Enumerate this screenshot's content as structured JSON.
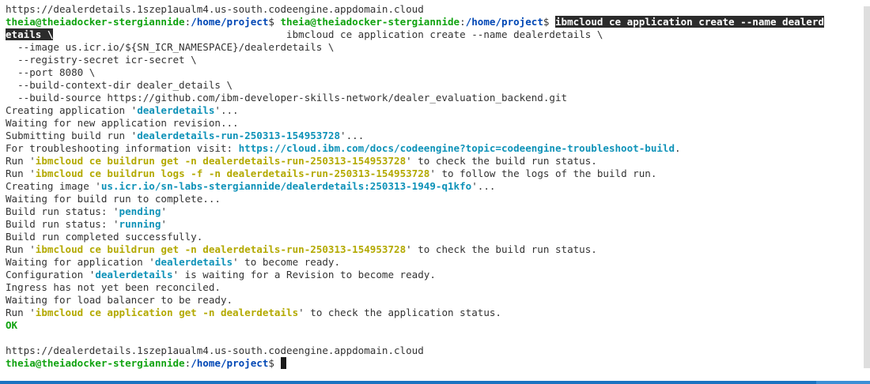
{
  "terminal": {
    "lines": [
      {
        "segments": [
          {
            "text": "https://dealerdetails.1szep1aualm4.us-south.codeengine.appdomain.cloud",
            "style": "plain"
          }
        ]
      },
      {
        "segments": [
          {
            "text": "theia@theiadocker-stergiannide",
            "style": "green"
          },
          {
            "text": ":",
            "style": "plain"
          },
          {
            "text": "/home/project",
            "style": "blue"
          },
          {
            "text": "$ ",
            "style": "plain"
          },
          {
            "text": "theia@theiadocker-stergiannide",
            "style": "green"
          },
          {
            "text": ":",
            "style": "plain"
          },
          {
            "text": "/home/project",
            "style": "blue"
          },
          {
            "text": "$ ",
            "style": "plain"
          },
          {
            "text": "ibmcloud ce application create --name dealerd",
            "style": "sel"
          }
        ]
      },
      {
        "segments": [
          {
            "text": "etails \\",
            "style": "sel"
          },
          {
            "text": "                                       ibmcloud ce application create --name dealerdetails \\",
            "style": "plain"
          }
        ]
      },
      {
        "segments": [
          {
            "text": "  --image us.icr.io/${SN_ICR_NAMESPACE}/dealerdetails \\",
            "style": "plain"
          }
        ]
      },
      {
        "segments": [
          {
            "text": "  --registry-secret icr-secret \\",
            "style": "plain"
          }
        ]
      },
      {
        "segments": [
          {
            "text": "  --port 8080 \\",
            "style": "plain"
          }
        ]
      },
      {
        "segments": [
          {
            "text": "  --build-context-dir dealer_details \\",
            "style": "plain"
          }
        ]
      },
      {
        "segments": [
          {
            "text": "  --build-source https://github.com/ibm-developer-skills-network/dealer_evaluation_backend.git",
            "style": "plain"
          }
        ]
      },
      {
        "segments": [
          {
            "text": "Creating application '",
            "style": "plain"
          },
          {
            "text": "dealerdetails",
            "style": "cyan-bold"
          },
          {
            "text": "'...",
            "style": "plain"
          }
        ]
      },
      {
        "segments": [
          {
            "text": "Waiting for new application revision...",
            "style": "plain"
          }
        ]
      },
      {
        "segments": [
          {
            "text": "Submitting build run '",
            "style": "plain"
          },
          {
            "text": "dealerdetails-run-250313-154953728",
            "style": "cyan-bold"
          },
          {
            "text": "'...",
            "style": "plain"
          }
        ]
      },
      {
        "segments": [
          {
            "text": "For troubleshooting information visit: ",
            "style": "plain"
          },
          {
            "text": "https://cloud.ibm.com/docs/codeengine?topic=codeengine-troubleshoot-build",
            "style": "cyan-bold"
          },
          {
            "text": ".",
            "style": "plain"
          }
        ]
      },
      {
        "segments": [
          {
            "text": "Run '",
            "style": "plain"
          },
          {
            "text": "ibmcloud ce buildrun get -n dealerdetails-run-250313-154953728",
            "style": "yellow"
          },
          {
            "text": "' to check the build run status.",
            "style": "plain"
          }
        ]
      },
      {
        "segments": [
          {
            "text": "Run '",
            "style": "plain"
          },
          {
            "text": "ibmcloud ce buildrun logs -f -n dealerdetails-run-250313-154953728",
            "style": "yellow"
          },
          {
            "text": "' to follow the logs of the build run.",
            "style": "plain"
          }
        ]
      },
      {
        "segments": [
          {
            "text": "Creating image '",
            "style": "plain"
          },
          {
            "text": "us.icr.io/sn-labs-stergiannide/dealerdetails:250313-1949-q1kfo",
            "style": "cyan-bold"
          },
          {
            "text": "'...",
            "style": "plain"
          }
        ]
      },
      {
        "segments": [
          {
            "text": "Waiting for build run to complete...",
            "style": "plain"
          }
        ]
      },
      {
        "segments": [
          {
            "text": "Build run status: '",
            "style": "plain"
          },
          {
            "text": "pending",
            "style": "cyan-bold"
          },
          {
            "text": "'",
            "style": "plain"
          }
        ]
      },
      {
        "segments": [
          {
            "text": "Build run status: '",
            "style": "plain"
          },
          {
            "text": "running",
            "style": "cyan-bold"
          },
          {
            "text": "'",
            "style": "plain"
          }
        ]
      },
      {
        "segments": [
          {
            "text": "Build run completed successfully.",
            "style": "plain"
          }
        ]
      },
      {
        "segments": [
          {
            "text": "Run '",
            "style": "plain"
          },
          {
            "text": "ibmcloud ce buildrun get -n dealerdetails-run-250313-154953728",
            "style": "yellow"
          },
          {
            "text": "' to check the build run status.",
            "style": "plain"
          }
        ]
      },
      {
        "segments": [
          {
            "text": "Waiting for application '",
            "style": "plain"
          },
          {
            "text": "dealerdetails",
            "style": "cyan-bold"
          },
          {
            "text": "' to become ready.",
            "style": "plain"
          }
        ]
      },
      {
        "segments": [
          {
            "text": "Configuration '",
            "style": "plain"
          },
          {
            "text": "dealerdetails",
            "style": "cyan-bold"
          },
          {
            "text": "' is waiting for a Revision to become ready.",
            "style": "plain"
          }
        ]
      },
      {
        "segments": [
          {
            "text": "Ingress has not yet been reconciled.",
            "style": "plain"
          }
        ]
      },
      {
        "segments": [
          {
            "text": "Waiting for load balancer to be ready.",
            "style": "plain"
          }
        ]
      },
      {
        "segments": [
          {
            "text": "Run '",
            "style": "plain"
          },
          {
            "text": "ibmcloud ce application get -n dealerdetails",
            "style": "yellow"
          },
          {
            "text": "' to check the application status.",
            "style": "plain"
          }
        ]
      },
      {
        "segments": [
          {
            "text": "OK",
            "style": "green"
          }
        ]
      },
      {
        "segments": [
          {
            "text": "",
            "style": "plain"
          }
        ]
      },
      {
        "segments": [
          {
            "text": "https://dealerdetails.1szep1aualm4.us-south.codeengine.appdomain.cloud",
            "style": "plain"
          }
        ]
      },
      {
        "segments": [
          {
            "text": "theia@theiadocker-stergiannide",
            "style": "green"
          },
          {
            "text": ":",
            "style": "plain"
          },
          {
            "text": "/home/project",
            "style": "blue"
          },
          {
            "text": "$ ",
            "style": "plain"
          }
        ],
        "cursor": true
      }
    ]
  },
  "colors": {
    "prompt_user": "#11a311",
    "prompt_path": "#0047b5",
    "quoted_value": "#0e92b8",
    "command_hint": "#b3a900",
    "selection_bg": "#2b2b2b",
    "status_bar": "#1b73c1"
  }
}
